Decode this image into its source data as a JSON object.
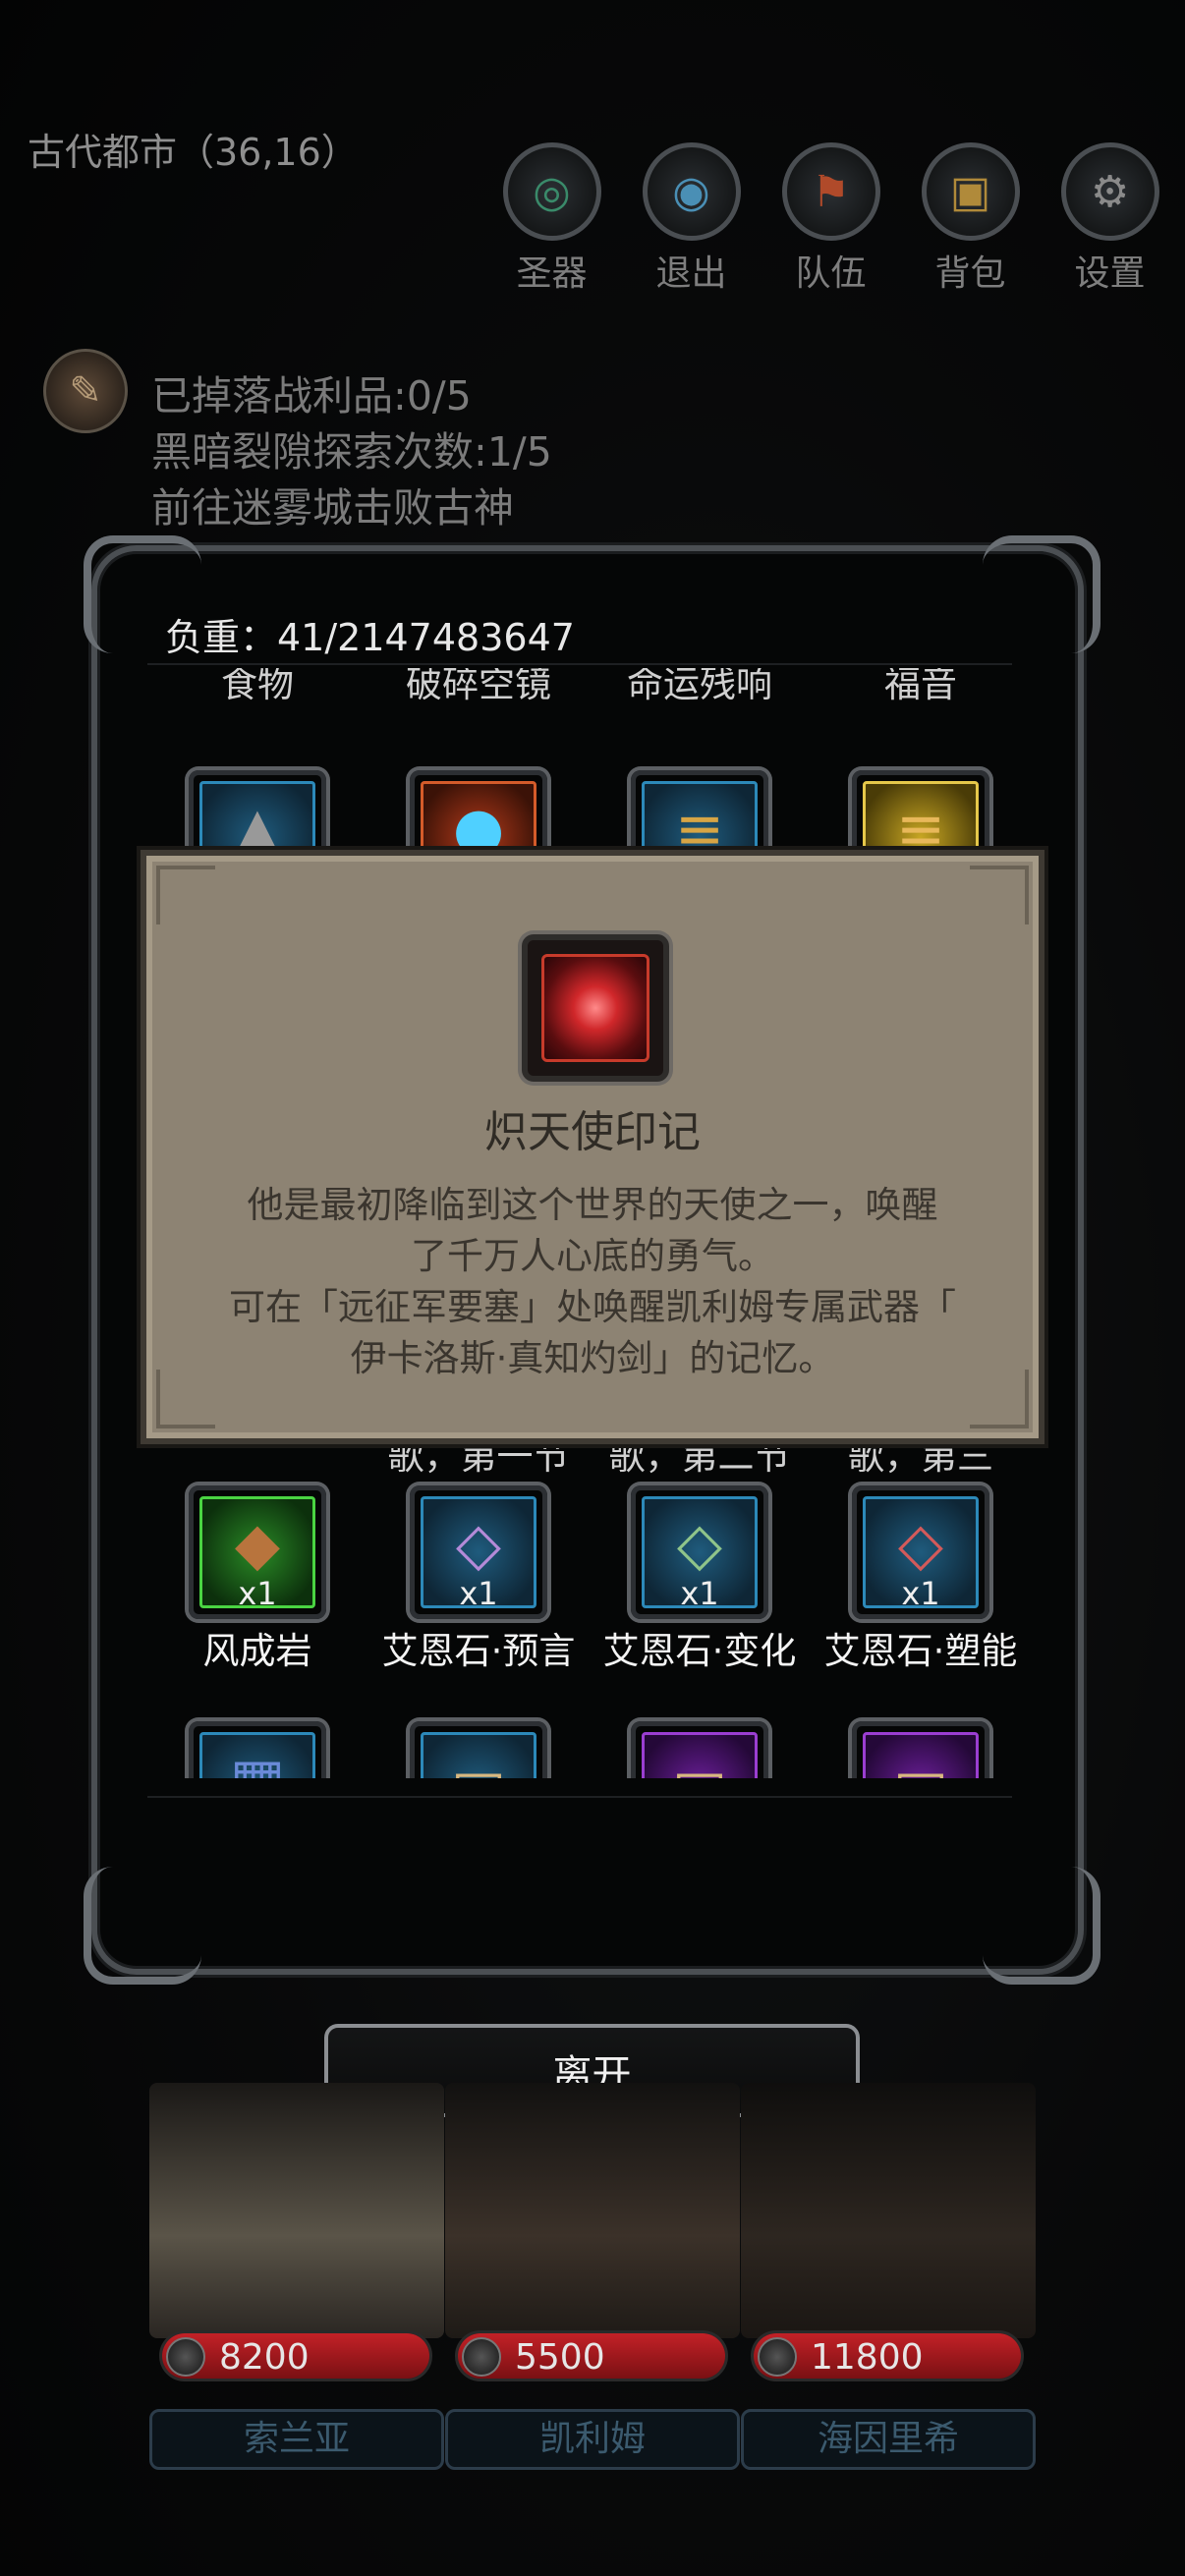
{
  "header": {
    "location": "古代都市（36,16）",
    "nav": [
      {
        "id": "artifact",
        "label": "圣器",
        "icon": "swirl-icon",
        "glyph": "◎"
      },
      {
        "id": "exit",
        "label": "退出",
        "icon": "portal-icon",
        "glyph": "◉"
      },
      {
        "id": "team",
        "label": "队伍",
        "icon": "team-banner-icon",
        "glyph": "⚑"
      },
      {
        "id": "bag",
        "label": "背包",
        "icon": "chest-icon",
        "glyph": "▣"
      },
      {
        "id": "settings",
        "label": "设置",
        "icon": "gear-icon",
        "glyph": "⚙"
      }
    ]
  },
  "quest": {
    "icon": "scroll-quill-icon",
    "lines": [
      "已掉落战利品:0/5",
      "黑暗裂隙探索次数:1/5",
      "前往迷雾城击败古神"
    ]
  },
  "bag": {
    "weight": "负重：41/2147483647",
    "row0_labels": [
      "食物",
      "破碎空镜",
      "命运残响",
      "福音"
    ],
    "row1": [
      {
        "quality": "blue",
        "icon": "ore-icon"
      },
      {
        "quality": "red",
        "icon": "blue-flame-icon"
      },
      {
        "quality": "blue",
        "icon": "wood-log-icon"
      },
      {
        "quality": "gold",
        "icon": "wood-log-icon"
      }
    ],
    "row2_labels": [
      "歌，第一节",
      "歌，第二节",
      "歌，第三"
    ],
    "row3": [
      {
        "quality": "green",
        "name": "风成岩",
        "qty": "x1",
        "icon": "rock-icon",
        "glyph": "◆"
      },
      {
        "quality": "blue",
        "name": "艾恩石·预言",
        "qty": "x1",
        "icon": "rune-stone-icon",
        "glyph": "◇"
      },
      {
        "quality": "blue",
        "name": "艾恩石·变化",
        "qty": "x1",
        "icon": "rune-stone-icon",
        "glyph": "◇"
      },
      {
        "quality": "blue",
        "name": "艾恩石·塑能",
        "qty": "x1",
        "icon": "rune-stone-icon",
        "glyph": "◇"
      }
    ],
    "row4": [
      {
        "quality": "blue",
        "icon": "rune-tablet-icon"
      },
      {
        "quality": "blue",
        "icon": "parchment-icon"
      },
      {
        "quality": "purple",
        "icon": "parchment-icon"
      },
      {
        "quality": "purple",
        "icon": "parchment-icon"
      }
    ]
  },
  "tooltip": {
    "icon": "angel-seal-icon",
    "title": "炽天使印记",
    "desc_lines": [
      "他是最初降临到这个世界的天使之一，唤醒",
      "了千万人心底的勇气。",
      "可在「远征军要塞」处唤醒凯利姆专属武器「",
      "伊卡洛斯·真知灼剑」的记忆。"
    ]
  },
  "leave_button": "离开",
  "heroes": [
    {
      "name": "索兰亚",
      "hp": "8200",
      "hp_fraction": 1.0,
      "portrait_color": "#5a5448"
    },
    {
      "name": "凯利姆",
      "hp": "5500",
      "hp_fraction": 1.0,
      "portrait_color": "#3b3129"
    },
    {
      "name": "海因里希",
      "hp": "11800",
      "hp_fraction": 1.0,
      "portrait_color": "#2d2620"
    }
  ]
}
